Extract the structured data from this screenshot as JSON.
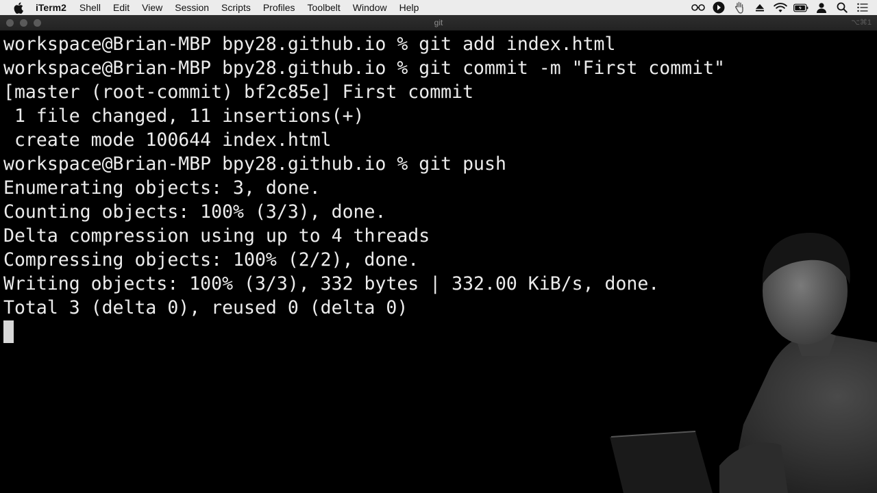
{
  "menubar": {
    "app_name": "iTerm2",
    "items": [
      "Shell",
      "Edit",
      "View",
      "Session",
      "Scripts",
      "Profiles",
      "Toolbelt",
      "Window",
      "Help"
    ],
    "status_icons": [
      "glasses-icon",
      "play-circle-icon",
      "hand-icon",
      "eject-icon",
      "wifi-icon",
      "battery-icon",
      "user-icon",
      "search-icon",
      "list-icon"
    ]
  },
  "window": {
    "title": "git",
    "shortcut": "⌥⌘1"
  },
  "terminal": {
    "lines": [
      "workspace@Brian-MBP bpy28.github.io % git add index.html",
      "workspace@Brian-MBP bpy28.github.io % git commit -m \"First commit\"",
      "[master (root-commit) bf2c85e] First commit",
      " 1 file changed, 11 insertions(+)",
      " create mode 100644 index.html",
      "workspace@Brian-MBP bpy28.github.io % git push",
      "Enumerating objects: 3, done.",
      "Counting objects: 100% (3/3), done.",
      "Delta compression using up to 4 threads",
      "Compressing objects: 100% (2/2), done.",
      "Writing objects: 100% (3/3), 332 bytes | 332.00 KiB/s, done.",
      "Total 3 (delta 0), reused 0 (delta 0)"
    ]
  },
  "colors": {
    "background": "#000000",
    "text": "#ececec",
    "menubar": "#ececec",
    "titlebar": "#2a2a2a"
  }
}
